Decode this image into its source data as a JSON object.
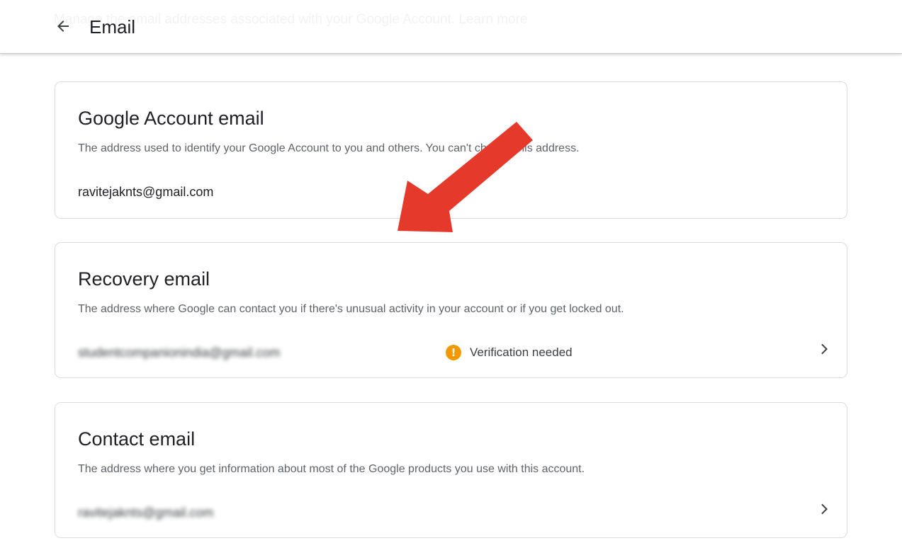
{
  "header": {
    "title": "Email",
    "ghost_text": "Manage the email addresses associated with your Google Account. Learn more"
  },
  "cards": [
    {
      "title": "Google Account email",
      "description": "The address used to identify your Google Account to you and others. You can't change this address.",
      "value": "ravitejaknts@gmail.com"
    },
    {
      "title": "Recovery email",
      "description": "The address where Google can contact you if there's unusual activity in your account or if you get locked out.",
      "value": "studentcompanionindia@gmail.com",
      "status": "Verification needed",
      "status_icon": "warning-icon",
      "status_color": "#f29900"
    },
    {
      "title": "Contact email",
      "description": "The address where you get information about most of the Google products you use with this account.",
      "value": "ravitejaknts@gmail.com"
    }
  ],
  "colors": {
    "annotation_arrow": "#e53a2b",
    "warning": "#f29900",
    "border": "#dadce0"
  },
  "icons": {
    "back": "arrow-back-icon",
    "chevron": "chevron-right-icon"
  }
}
